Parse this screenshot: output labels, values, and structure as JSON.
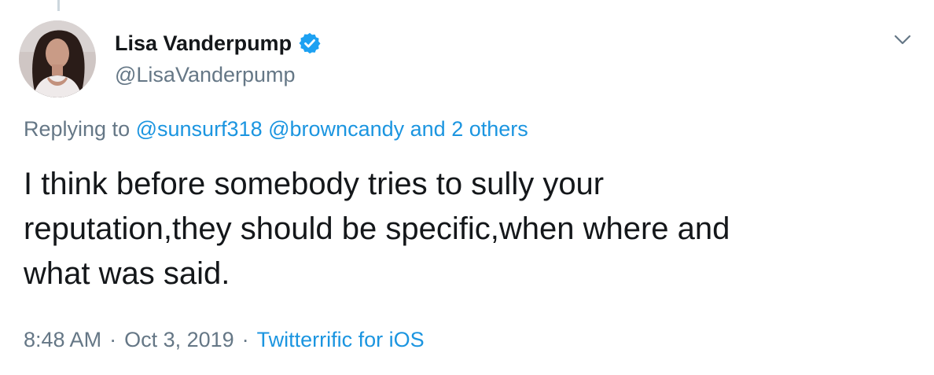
{
  "tweet": {
    "author": {
      "display_name": "Lisa Vanderpump",
      "handle": "@LisaVanderpump",
      "verified": true,
      "avatar_icon": "profile-photo"
    },
    "menu_icon": "chevron-down-icon",
    "replying": {
      "prefix": "Replying to",
      "mentions": [
        "@sunsurf318",
        "@browncandy"
      ],
      "others": "and 2 others"
    },
    "text_lines": [
      "I think before somebody tries to sully your",
      "reputation,they should be specific,when where and",
      "what was said."
    ],
    "time": "8:48 AM",
    "separator": "·",
    "date": "Oct 3, 2019",
    "source": "Twitterrific for iOS"
  },
  "colors": {
    "text": "#14171a",
    "secondary": "#657786",
    "link": "#1b95e0",
    "verified": "#1da1f2"
  }
}
